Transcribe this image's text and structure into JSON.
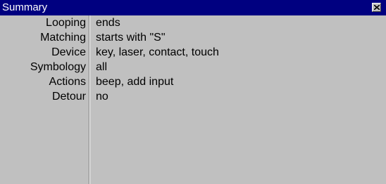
{
  "window": {
    "title": "Summary",
    "close_icon": "close-x-icon",
    "title_bar_color": "#000080",
    "background_color": "#c0c0c0"
  },
  "summary": {
    "rows": [
      {
        "label": "Looping",
        "value": "ends"
      },
      {
        "label": "Matching",
        "value": "starts with \"S\""
      },
      {
        "label": "Device",
        "value": "key, laser, contact, touch"
      },
      {
        "label": "Symbology",
        "value": "all"
      },
      {
        "label": "Actions",
        "value": "beep, add input"
      },
      {
        "label": "Detour",
        "value": "no"
      }
    ]
  }
}
